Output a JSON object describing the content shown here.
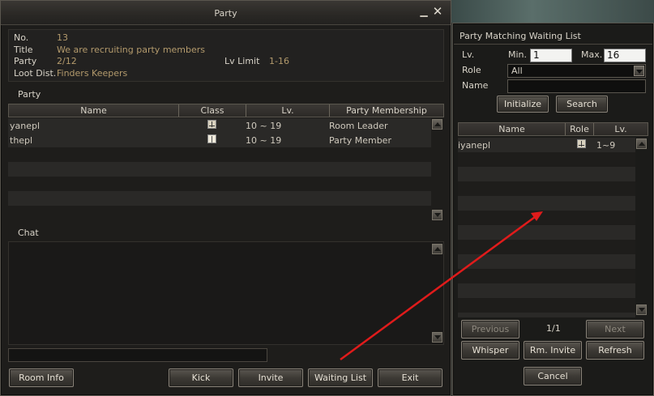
{
  "party_window": {
    "title": "Party",
    "info": {
      "no_label": "No.",
      "no_value": "13",
      "title_label": "Title",
      "title_value": "We are recruiting party members",
      "party_label": "Party",
      "party_value": "2/12",
      "lv_limit_label": "Lv Limit",
      "lv_limit_value": "1-16",
      "loot_label": "Loot Dist.",
      "loot_value": "Finders Keepers"
    },
    "party_section_label": "Party",
    "party_table": {
      "headers": [
        "Name",
        "Class",
        "Lv.",
        "Party Membership"
      ],
      "rows": [
        {
          "name": "yanepl",
          "class_icon": "sword-icon",
          "lv": "10 ~ 19",
          "membership": "Room Leader"
        },
        {
          "name": "thepl",
          "class_icon": "book-icon",
          "lv": "10 ~ 19",
          "membership": "Party Member"
        }
      ]
    },
    "chat_label": "Chat",
    "chat_input_value": "",
    "buttons": {
      "room_info": "Room Info",
      "kick": "Kick",
      "invite": "Invite",
      "waiting_list": "Waiting List",
      "exit": "Exit"
    }
  },
  "waiting_window": {
    "title": "Party Matching Waiting List",
    "lv_label": "Lv.",
    "min_label": "Min.",
    "min_value": "1",
    "max_label": "Max.",
    "max_value": "16",
    "role_label": "Role",
    "role_value": "All",
    "name_label": "Name",
    "name_value": "",
    "initialize": "Initialize",
    "search": "Search",
    "table": {
      "headers": [
        "Name",
        "Role",
        "Lv."
      ],
      "rows": [
        {
          "name": "iyanepl",
          "role_icon": "sword-icon",
          "lv": "1~9"
        }
      ]
    },
    "previous": "Previous",
    "page": "1/1",
    "next": "Next",
    "whisper": "Whisper",
    "rm_invite": "Rm. Invite",
    "refresh": "Refresh",
    "cancel": "Cancel"
  },
  "annotation": {
    "arrow_color": "#e01b1b"
  }
}
